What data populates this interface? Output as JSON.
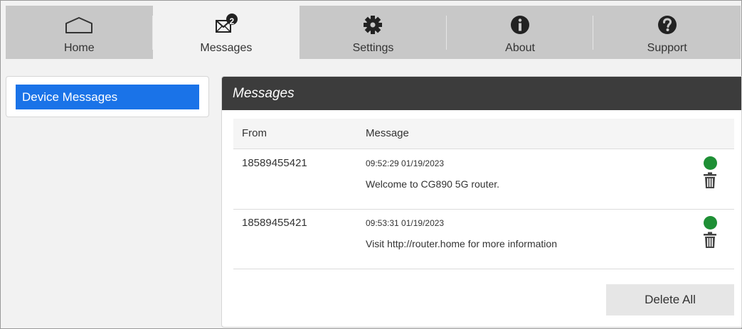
{
  "nav": {
    "items": [
      {
        "label": "Home",
        "icon": "home-icon"
      },
      {
        "label": "Messages",
        "icon": "envelope-icon",
        "badge": "2"
      },
      {
        "label": "Settings",
        "icon": "gear-icon"
      },
      {
        "label": "About",
        "icon": "info-icon"
      },
      {
        "label": "Support",
        "icon": "question-icon"
      }
    ],
    "active": "Messages"
  },
  "sidebar": {
    "items": [
      {
        "label": "Device Messages",
        "selected": true
      }
    ]
  },
  "panel": {
    "title": "Messages",
    "columns": {
      "from": "From",
      "message": "Message"
    },
    "messages": [
      {
        "from": "18589455421",
        "time": "09:52:29 01/19/2023",
        "text": "Welcome to CG890 5G router.",
        "status": "unread"
      },
      {
        "from": "18589455421",
        "time": "09:53:31 01/19/2023",
        "text": "Visit http://router.home for more information",
        "status": "unread"
      }
    ],
    "delete_all_label": "Delete All"
  },
  "colors": {
    "nav_bg": "#c8c8c8",
    "active_tab_bg": "#f2f2f2",
    "header_bg": "#3c3c3c",
    "selected_item": "#1a73e8",
    "status_dot": "#1e8f35"
  }
}
